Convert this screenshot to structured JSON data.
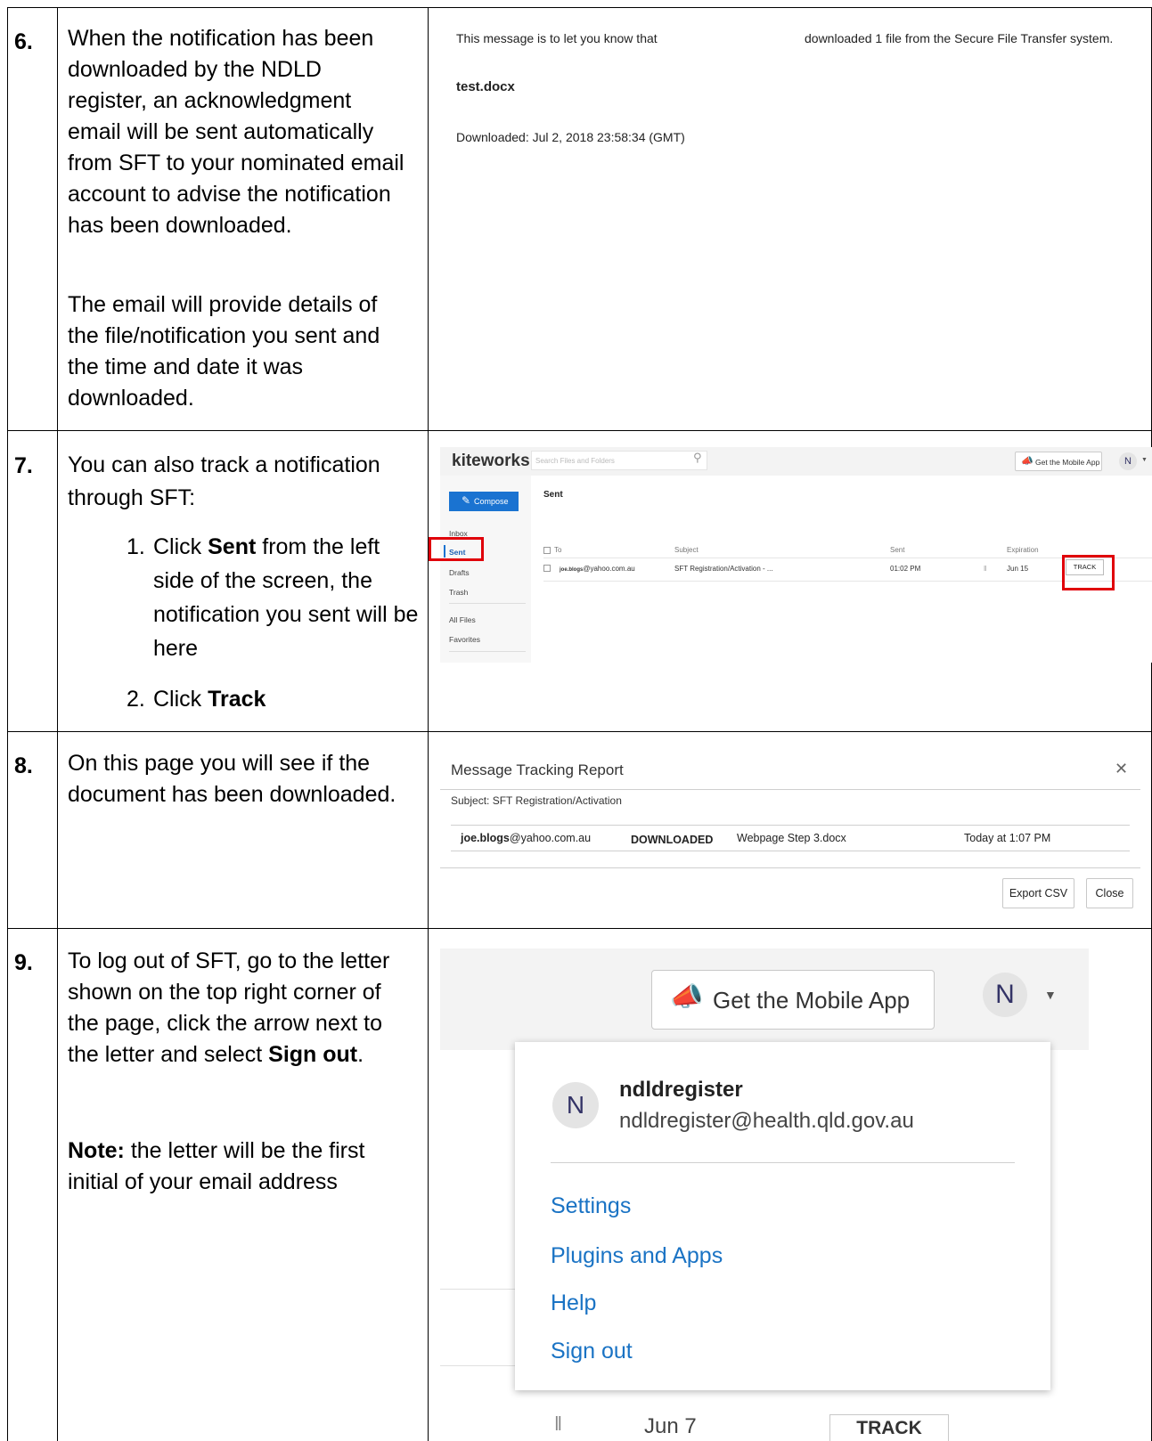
{
  "steps": {
    "s6": {
      "num": "6.",
      "p1": "When the notification has been downloaded by the NDLD register, an acknowledgment email will be sent automatically from SFT to your nominated email account to advise the notification has been downloaded.",
      "p2": "The email will provide details of the file/notification you sent and the time and date it was downloaded."
    },
    "s7": {
      "num": "7.",
      "intro": "You can also track a notification through SFT:",
      "li1_num": "1.",
      "li1_pre": "Click ",
      "li1_bold": "Sent",
      "li1_post": " from the left side of the screen, the notification you sent will be here",
      "li2_num": "2.",
      "li2_pre": "Click ",
      "li2_bold": "Track"
    },
    "s8": {
      "num": "8.",
      "text": "On this page you will see if the document has been downloaded."
    },
    "s9": {
      "num": "9.",
      "pre": "To log out of SFT, go to the letter shown on the top right corner of the page, click the arrow next to the letter and select ",
      "bold": "Sign out",
      "post": ".",
      "note_bold": "Note:",
      "note_text": " the letter will be the first initial of your email address"
    }
  },
  "email": {
    "line1_left": "This message is to let you know that",
    "line1_right": "downloaded 1 file from the Secure File Transfer system.",
    "file": "test.docx",
    "downloaded": "Downloaded: Jul 2, 2018 23:58:34 (GMT)"
  },
  "kiteworks": {
    "logo": "kiteworks",
    "search_placeholder": "Search Files and Folders",
    "mobile_app": "Get the Mobile App",
    "avatar": "N",
    "compose": "Compose",
    "nav": [
      "Inbox",
      "Sent",
      "Drafts",
      "Trash",
      "All Files",
      "Favorites"
    ],
    "title": "Sent",
    "columns": [
      "To",
      "Subject",
      "Sent",
      "Expiration"
    ],
    "row": {
      "to_bold": "joe.blogs",
      "to_rest": "@yahoo.com.au",
      "subject": "SFT Registration/Activation  - ...",
      "sent": "01:02 PM",
      "expiration": "Jun 15",
      "track": "TRACK"
    }
  },
  "report": {
    "title": "Message Tracking Report",
    "subject": "Subject: SFT Registration/Activation",
    "user_bold": "joe.blogs",
    "user_rest": "@yahoo.com.au",
    "status": "DOWNLOADED",
    "file": "Webpage Step 3.docx",
    "time": "Today at 1:07 PM",
    "export": "Export CSV",
    "close": "Close"
  },
  "usermenu": {
    "mobile_app": "Get the Mobile App",
    "avatar": "N",
    "name": "ndldregister",
    "email": "ndldregister@health.qld.gov.au",
    "items": [
      "Settings",
      "Plugins and Apps",
      "Help",
      "Sign out"
    ],
    "bg_date": "Jun 7",
    "bg_track": "TRACK"
  }
}
